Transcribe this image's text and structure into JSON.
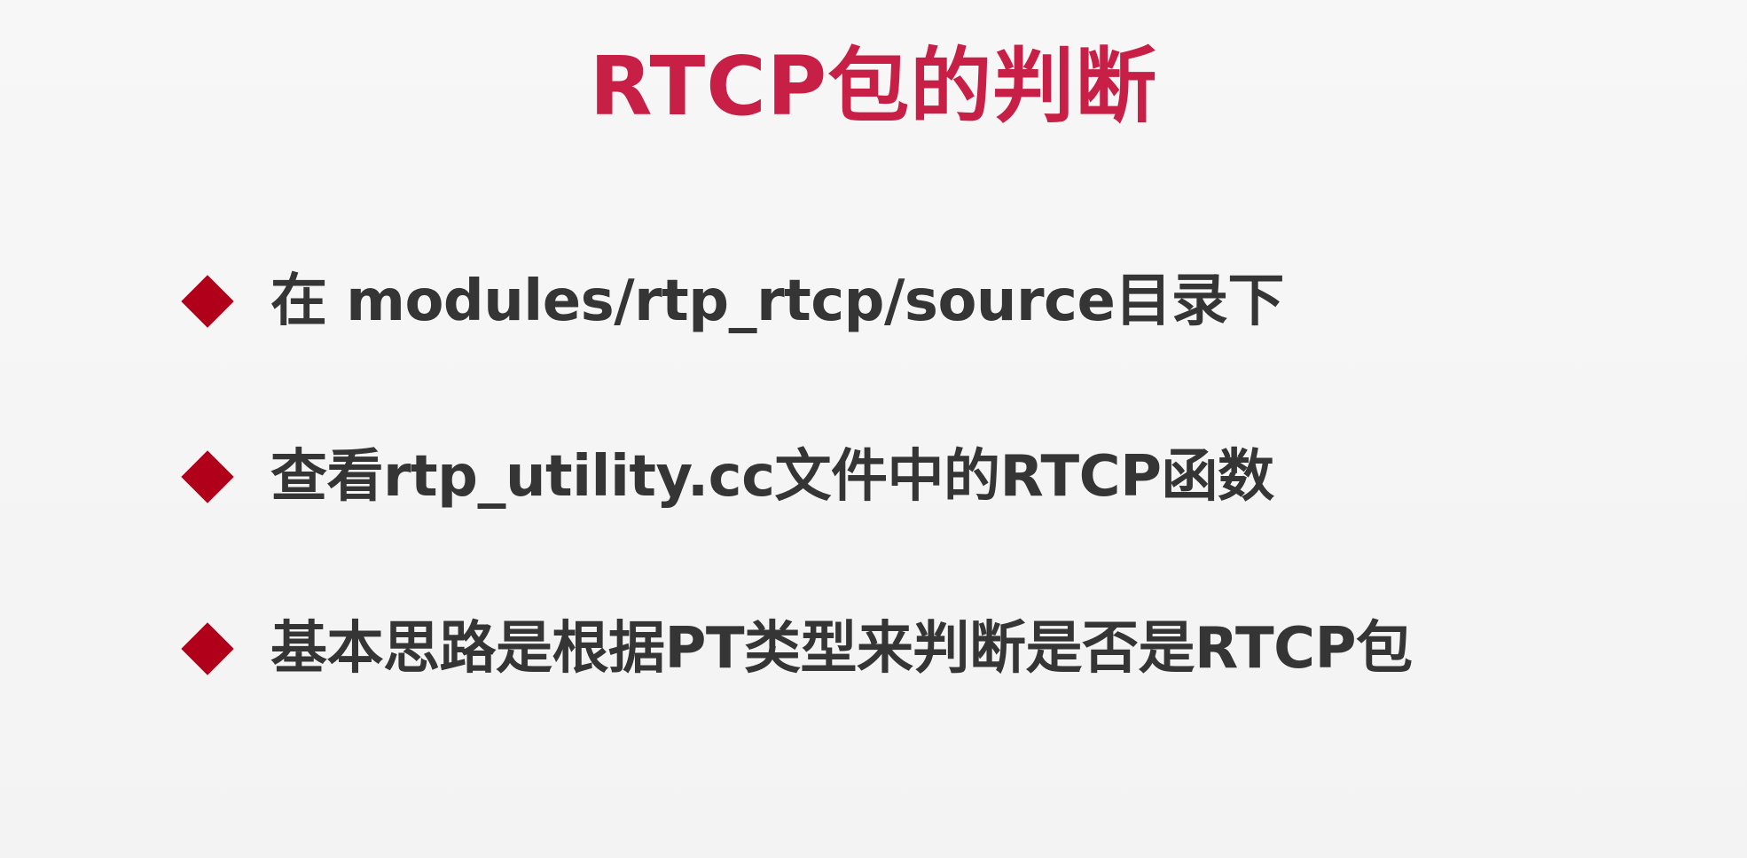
{
  "slide": {
    "title": "RTCP包的判断",
    "bullets": [
      {
        "text": "在 modules/rtp_rtcp/source目录下"
      },
      {
        "text": "查看rtp_utility.cc文件中的RTCP函数"
      },
      {
        "text": "基本思路是根据PT类型来判断是否是RTCP包"
      }
    ]
  },
  "colors": {
    "title": "#c71f45",
    "bullet_marker": "#b0001a",
    "body_text": "#353535",
    "background": "#f5f5f5"
  },
  "icons": {
    "bullet_marker": "diamond-bullet-icon"
  }
}
